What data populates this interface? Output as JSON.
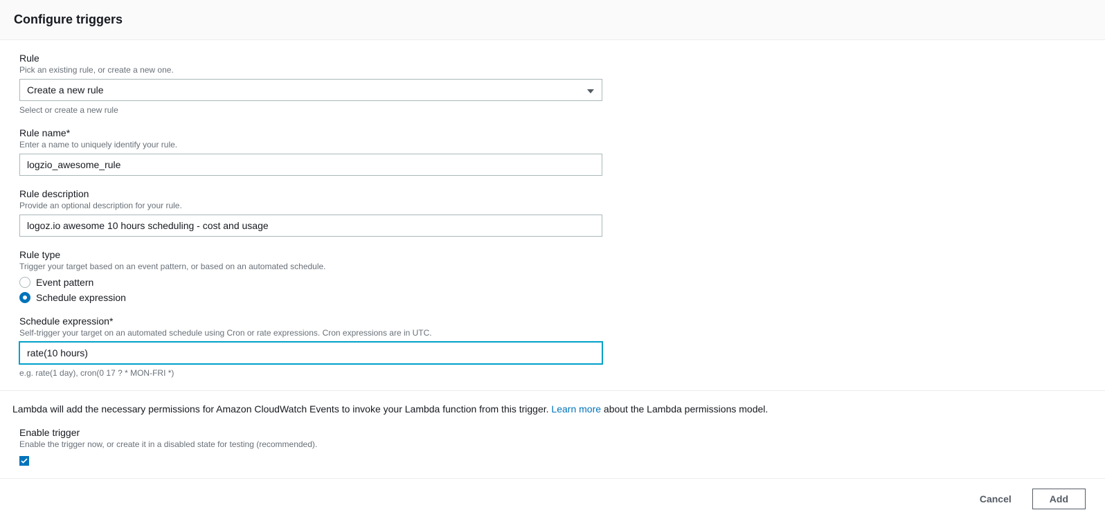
{
  "header": {
    "title": "Configure triggers"
  },
  "rule": {
    "label": "Rule",
    "hint": "Pick an existing rule, or create a new one.",
    "selected": "Create a new rule",
    "bottom_hint": "Select or create a new rule"
  },
  "rule_name": {
    "label": "Rule name*",
    "hint": "Enter a name to uniquely identify your rule.",
    "value": "logzio_awesome_rule"
  },
  "rule_description": {
    "label": "Rule description",
    "hint": "Provide an optional description for your rule.",
    "value": "logoz.io awesome 10 hours scheduling - cost and usage"
  },
  "rule_type": {
    "label": "Rule type",
    "hint": "Trigger your target based on an event pattern, or based on an automated schedule.",
    "options": {
      "event_pattern": "Event pattern",
      "schedule_expression": "Schedule expression"
    }
  },
  "schedule_expression": {
    "label": "Schedule expression*",
    "hint": "Self-trigger your target on an automated schedule using Cron or rate expressions. Cron expressions are in UTC.",
    "value": "rate(10 hours)",
    "example": "e.g. rate(1 day), cron(0 17 ? * MON-FRI *)"
  },
  "permissions_info": {
    "prefix": "Lambda will add the necessary permissions for Amazon CloudWatch Events to invoke your Lambda function from this trigger. ",
    "link": "Learn more",
    "suffix": " about the Lambda permissions model."
  },
  "enable_trigger": {
    "label": "Enable trigger",
    "hint": "Enable the trigger now, or create it in a disabled state for testing (recommended)."
  },
  "footer": {
    "cancel": "Cancel",
    "add": "Add"
  }
}
